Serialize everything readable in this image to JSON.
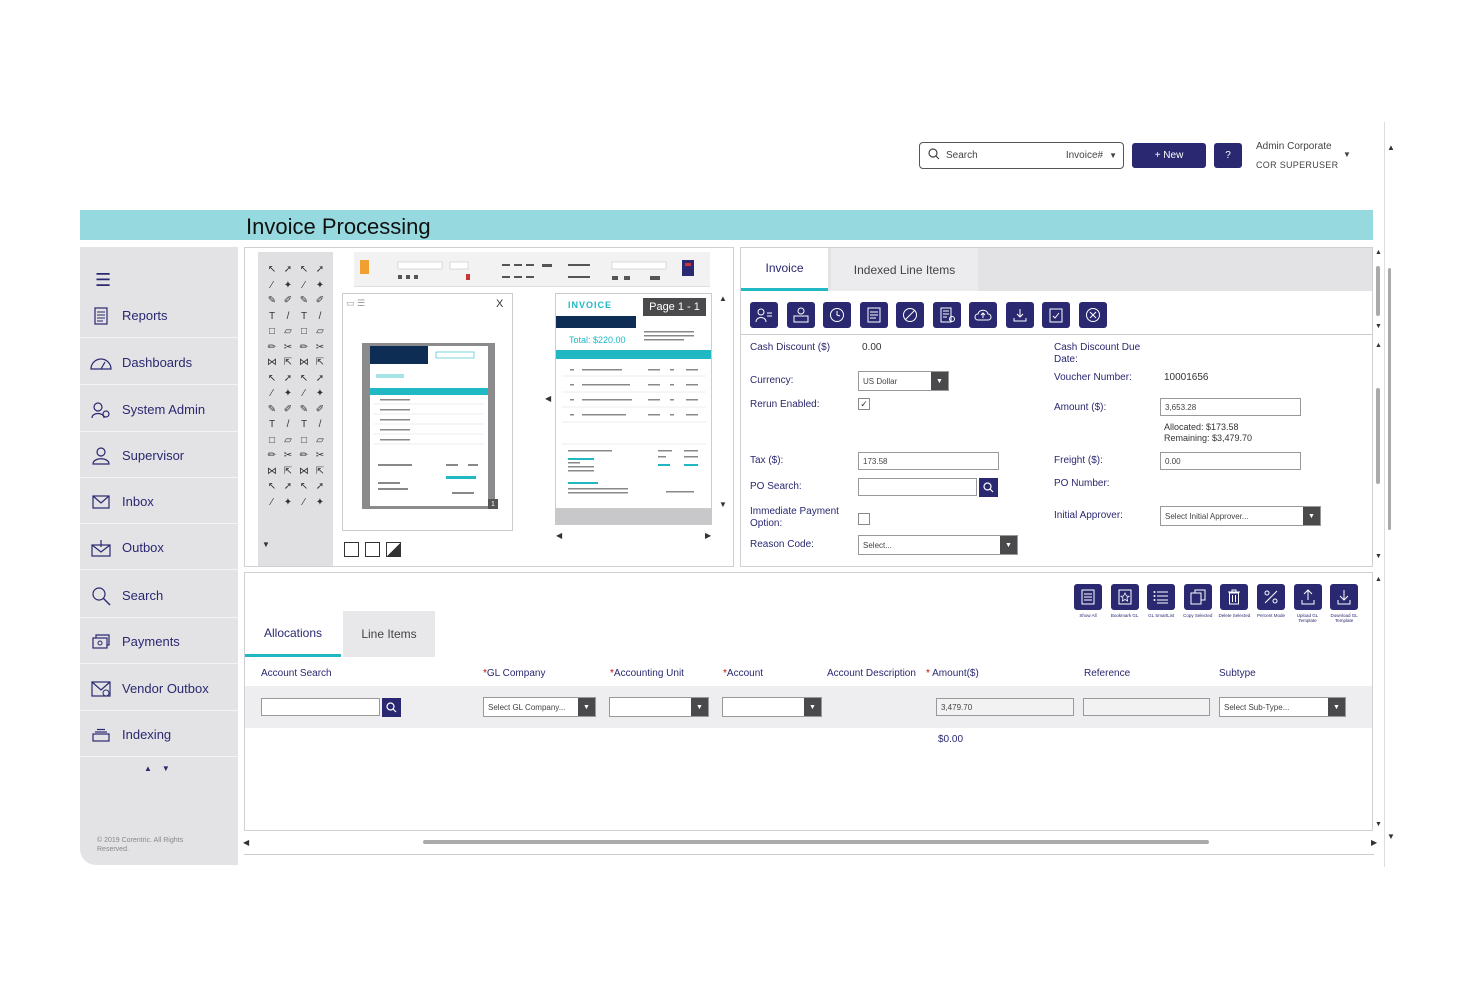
{
  "header": {
    "search_placeholder": "Search",
    "search_type": "Invoice#",
    "new_label": "+ New",
    "help_label": "?",
    "user_name": "Admin Corporate",
    "user_role": "COR SUPERUSER"
  },
  "page": {
    "title": "Invoice Processing"
  },
  "sidebar": {
    "items": [
      {
        "label": "Reports",
        "icon": "report-icon"
      },
      {
        "label": "Dashboards",
        "icon": "gauge-icon"
      },
      {
        "label": "System Admin",
        "icon": "users-gear-icon"
      },
      {
        "label": "Supervisor",
        "icon": "person-icon"
      },
      {
        "label": "Inbox",
        "icon": "envelope-icon"
      },
      {
        "label": "Outbox",
        "icon": "outbox-icon"
      },
      {
        "label": "Search",
        "icon": "search-icon"
      },
      {
        "label": "Payments",
        "icon": "payments-icon"
      },
      {
        "label": "Vendor Outbox",
        "icon": "vendor-outbox-icon"
      },
      {
        "label": "Indexing",
        "icon": "stack-icon"
      }
    ],
    "copyright": "© 2019 Corentric. All Rights Reserved."
  },
  "viewer": {
    "thumb_close": "X",
    "doc_title": "INVOICE",
    "page_badge": "Page 1 - 1",
    "doc_total": "Total: $220.00"
  },
  "tabs": [
    {
      "label": "Invoice",
      "active": true
    },
    {
      "label": "Indexed Line Items",
      "active": false
    }
  ],
  "form": {
    "cash_discount_label": "Cash Discount ($)",
    "cash_discount_value": "0.00",
    "cash_discount_due_label": "Cash Discount Due Date:",
    "currency_label": "Currency:",
    "currency_value": "US Dollar",
    "voucher_label": "Voucher Number:",
    "voucher_value": "10001656",
    "rerun_label": "Rerun Enabled:",
    "rerun_checked": "✓",
    "amount_label": "Amount ($):",
    "amount_value": "3,653.28",
    "allocated_text": "Allocated: $173.58",
    "remaining_text": "Remaining: $3,479.70",
    "tax_label": "Tax ($):",
    "tax_value": "173.58",
    "freight_label": "Freight ($):",
    "freight_value": "0.00",
    "po_search_label": "PO Search:",
    "po_number_label": "PO Number:",
    "immediate_label": "Immediate Payment Option:",
    "initial_approver_label": "Initial Approver:",
    "initial_approver_value": "Select Initial Approver...",
    "reason_label": "Reason Code:",
    "reason_value": "Select..."
  },
  "bottom": {
    "tools": [
      {
        "label": "Show All",
        "icon": "list-box-icon"
      },
      {
        "label": "Bookmark GL",
        "icon": "bookmark-icon"
      },
      {
        "label": "GL SmartList",
        "icon": "list-icon"
      },
      {
        "label": "Copy Selected",
        "icon": "copy-icon"
      },
      {
        "label": "Delete Selected",
        "icon": "trash-icon"
      },
      {
        "label": "Percent Mode",
        "icon": "percent-icon"
      },
      {
        "label": "Upload GL Template",
        "icon": "upload-icon"
      },
      {
        "label": "Download GL Template",
        "icon": "download-icon"
      }
    ],
    "tabs": [
      {
        "label": "Allocations",
        "active": true
      },
      {
        "label": "Line Items",
        "active": false
      }
    ],
    "columns": {
      "account_search": "Account Search",
      "gl_company": "GL Company",
      "accounting_unit": "Accounting Unit",
      "account": "Account",
      "account_description": "Account Description",
      "amount": "Amount($)",
      "reference": "Reference",
      "subtype": "Subtype"
    },
    "row": {
      "gl_company_value": "Select GL Company...",
      "amount_value": "3,479.70",
      "subtype_value": "Select Sub-Type..."
    },
    "total": "$0.00"
  },
  "colors": {
    "brand_navy": "#2a2870",
    "accent_teal": "#1fb8c3",
    "title_bar": "#96d9de"
  }
}
